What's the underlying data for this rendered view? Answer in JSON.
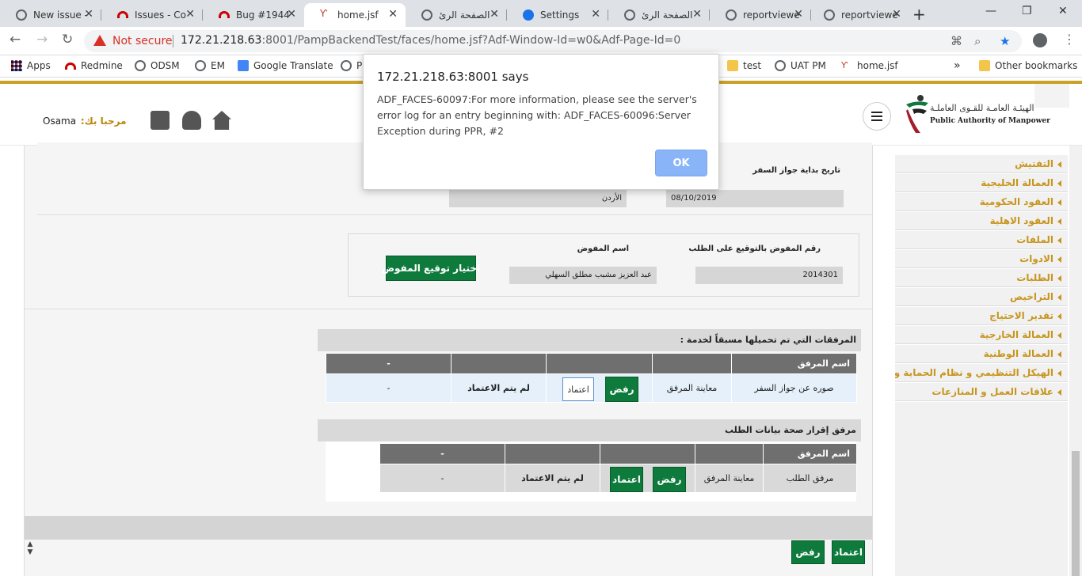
{
  "browser": {
    "tabs": [
      {
        "title": "New issue -",
        "icon": "globe-icon"
      },
      {
        "title": "Issues - Co",
        "icon": "redmine-icon"
      },
      {
        "title": "Bug #1944",
        "icon": "redmine-icon"
      },
      {
        "title": "home.jsf",
        "icon": "fork-icon",
        "active": true
      },
      {
        "title": "الصفحة الرئ",
        "icon": "globe-icon"
      },
      {
        "title": "Settings",
        "icon": "gear-icon"
      },
      {
        "title": "الصفحة الرئ",
        "icon": "globe-icon"
      },
      {
        "title": "reportviewe",
        "icon": "globe-icon"
      },
      {
        "title": "reportviewe",
        "icon": "globe-icon"
      }
    ],
    "new_tab": "+",
    "window_controls": {
      "minimize": "—",
      "maximize": "❐",
      "close": "✕"
    },
    "security_label": "Not secure",
    "url_host": "172.21.218.63",
    "url_rest": ":8001/PampBackendTest/faces/home.jsf?Adf-Window-Id=w0&Adf-Page-Id=0",
    "bookmarks": [
      "Apps",
      "Redmine",
      "ODSM",
      "EM",
      "Google Translate",
      "P",
      "test",
      "UAT PM",
      "home.jsf"
    ],
    "more_bookmarks": "»",
    "other_bookmarks": "Other bookmarks"
  },
  "header": {
    "user_name": "Osama",
    "greeting": ":مرحبا بك",
    "logo_ar": "الهيئـة العامـة للقـوى العاملـة",
    "logo_en": "Public Authority of Manpower"
  },
  "form": {
    "passport_start_label": "تاريخ بداية جواز السفر",
    "passport_start_value": "08/10/2019",
    "country_value": "الأردن",
    "delegate_number_label": "رقم المفوض بالتوقيع على الطلب",
    "delegate_number_value": "2014301",
    "delegate_name_label": "اسم المفوض",
    "delegate_name_value": "عبد العزيز مشبب مطلق السهلي",
    "choose_delegate_button": "اختيار توقيع المفوض"
  },
  "attachments1": {
    "title": "المرفقات التي تم تحميلها مسبقاً لخدمة :",
    "headers": [
      "اسم المرفق",
      "",
      "",
      "",
      "-"
    ],
    "row": {
      "name": "صوره عن جواز السفر",
      "view": "معاينة المرفق",
      "approve": "اعتماد",
      "reject": "رفض",
      "status": "لم يتم الاعتماد",
      "extra": "-"
    }
  },
  "attachments2": {
    "title": "مرفق إقرار صحة بيانات الطلب",
    "headers": [
      "اسم المرفق",
      "",
      "",
      "",
      "-"
    ],
    "row": {
      "name": "مرفق الطلب",
      "view": "معاينة المرفق",
      "approve": "اعتماد",
      "reject": "رفض",
      "status": "لم يتم الاعتماد",
      "extra": "-"
    }
  },
  "footer": {
    "approve": "اعتماد",
    "reject": "رفض"
  },
  "sidebar": {
    "items": [
      "التفتيش",
      "العمالة الخليجية",
      "العقود الحكومية",
      "العقود الاهلية",
      "الملفات",
      "الادوات",
      "الطلبات",
      "التراخيص",
      "تقدير الاحتياج",
      "العمالة الخارجية",
      "العمالة الوطنية",
      "الهيكل التنظيمي و نظام الحماية و الامن",
      "علاقات العمل و المنازعات"
    ]
  },
  "dialog": {
    "title": "172.21.218.63:8001 says",
    "message": "ADF_FACES-60097:For more information, please see the server's error log for an entry beginning with: ADF_FACES-60096:Server Exception during PPR, #2",
    "ok": "OK"
  },
  "colors": {
    "accent_gold": "#c9a227",
    "button_green": "#0e7a3c",
    "ok_blue": "#8ab4f8"
  }
}
